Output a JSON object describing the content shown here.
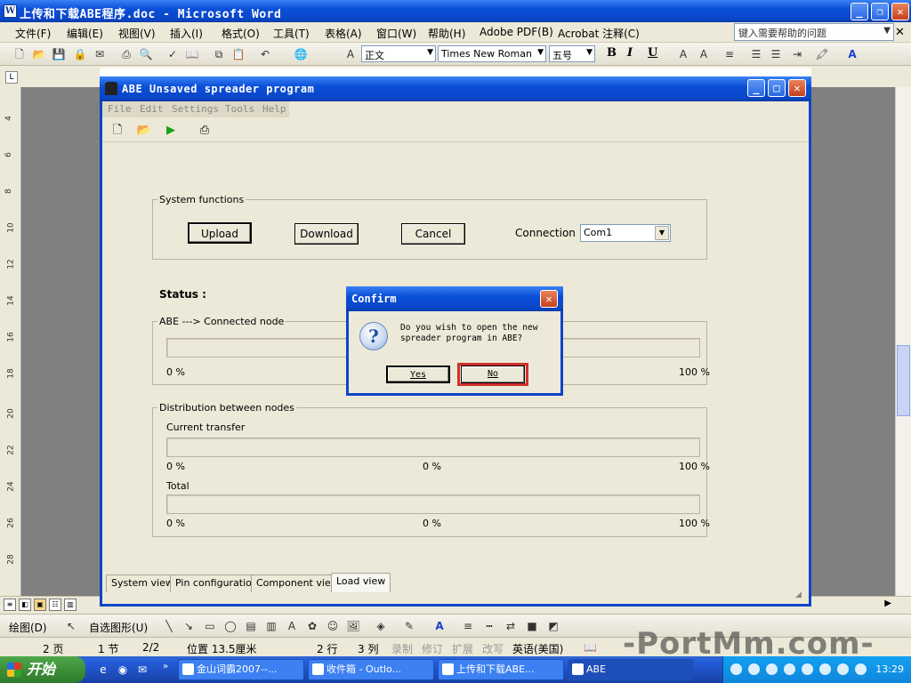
{
  "word": {
    "title": "上传和下载ABE程序.doc - Microsoft Word",
    "menu": [
      "文件(F)",
      "编辑(E)",
      "视图(V)",
      "插入(I)",
      "格式(O)",
      "工具(T)",
      "表格(A)",
      "窗口(W)",
      "帮助(H)",
      "Adobe PDF(B)",
      "Acrobat 注释(C)"
    ],
    "help_placeholder": "键入需要帮助的问题",
    "style_value": "正文",
    "font_value": "Times New Roman",
    "size_value": "五号",
    "ruler_ticks": [
      "4",
      "6",
      "8",
      "10",
      "12",
      "14",
      "16",
      "18",
      "20",
      "22",
      "24",
      "26",
      "28"
    ],
    "draw_label": "绘图(D)",
    "autoshape_label": "自选图形(U)",
    "status": {
      "page": "2 页",
      "section": "1 节",
      "pages": "2/2",
      "position": "位置 13.5厘米",
      "line": "2 行",
      "column": "3 列",
      "rec": "录制",
      "trk": "修订",
      "ext": "扩展",
      "ovr": "改写",
      "lang": "英语(美国)"
    }
  },
  "taskbar": {
    "start": "开始",
    "tasks": [
      "金山词霸2007--...",
      "收件箱 - Outlo...",
      "上传和下载ABE...",
      "ABE"
    ],
    "clock": "13:29"
  },
  "watermark": "-PortMm.com-",
  "abe": {
    "title": "ABE Unsaved spreader program",
    "menu": [
      "File",
      "Edit",
      "Settings",
      "Tools",
      "Help"
    ],
    "system_functions_label": "System functions",
    "upload": "Upload",
    "download": "Download",
    "cancel": "Cancel",
    "connection_label": "Connection :",
    "connection_value": "Com1",
    "status_label": "Status :",
    "connected_node_label": "ABE ---> Connected node",
    "distribution_label": "Distribution between nodes",
    "current_transfer_label": "Current transfer",
    "total_label": "Total",
    "pct_min": "0 %",
    "pct_mid": "0 %",
    "pct_max": "100 %",
    "tabs": [
      "System view",
      "Pin configuration",
      "Component view",
      "Load view"
    ],
    "progress": {
      "connected_node": 0,
      "current_transfer": 0,
      "total": 0
    }
  },
  "confirm": {
    "title": "Confirm",
    "message": "Do you wish to open the new\nspreader program in ABE?",
    "yes": "Yes",
    "no": "No"
  },
  "colors": {
    "title_blue": "#0a46c8",
    "highlight_red": "#d0302c",
    "face": "#ece9d8"
  }
}
